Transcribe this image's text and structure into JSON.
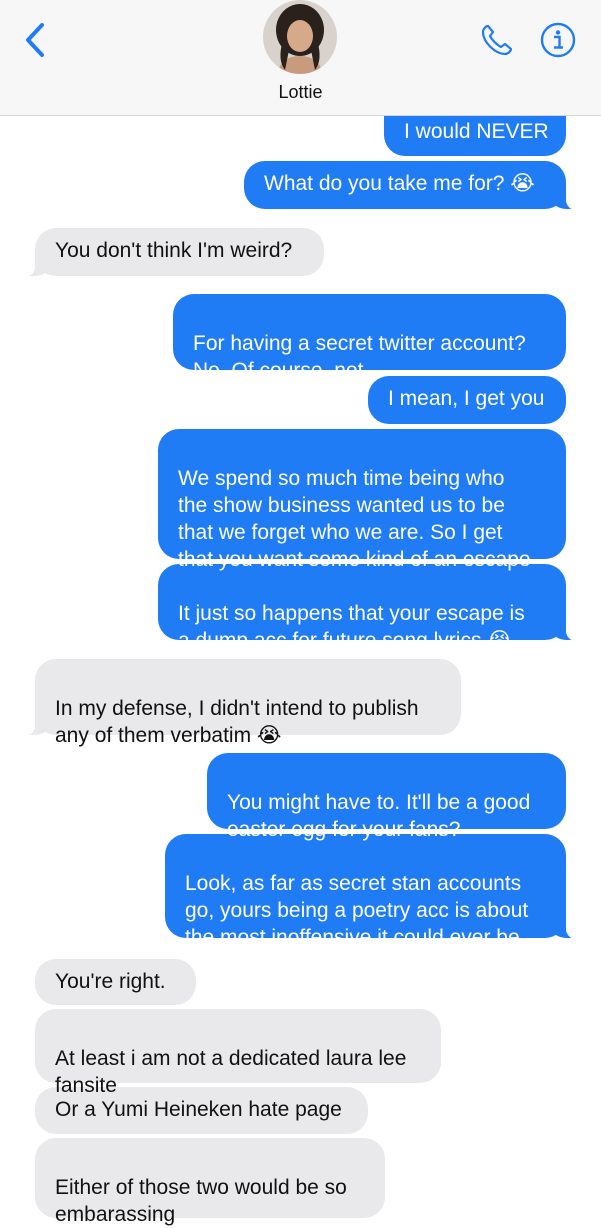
{
  "header": {
    "contact_name": "Lottie",
    "back_icon": "chevron-left-icon",
    "call_icon": "phone-icon",
    "info_icon": "info-icon",
    "accent_color": "#1f7cf5"
  },
  "messages": [
    {
      "from": "me",
      "text": "I would NEVER"
    },
    {
      "from": "me",
      "text": "What do you take me for? 😭"
    },
    {
      "from": "them",
      "text": "You don't think I'm weird?"
    },
    {
      "from": "me",
      "text": "For having a secret twitter account?\nNo. Of course, not."
    },
    {
      "from": "me",
      "text": "I mean, I get you"
    },
    {
      "from": "me",
      "text": "We spend so much time being who\nthe show business wanted us to be\nthat we forget who we are. So I get\nthat you want some kind of an escape"
    },
    {
      "from": "me",
      "text": "It just so happens that your escape is\na dump acc for future song lyrics 😭"
    },
    {
      "from": "them",
      "text": "In my defense, I didn't intend to publish\nany of them verbatim 😭"
    },
    {
      "from": "me",
      "text": "You might have to. It'll be a good\neaster egg for your fans?"
    },
    {
      "from": "me",
      "text": "Look, as far as secret stan accounts\ngo, yours being a poetry acc is about\nthe most inoffensive it could ever be"
    },
    {
      "from": "them",
      "text": "You're right."
    },
    {
      "from": "them",
      "text": "At least i am not a dedicated laura lee\nfansite"
    },
    {
      "from": "them",
      "text": "Or a Yumi Heineken hate page"
    },
    {
      "from": "them",
      "text": "Either of those two would be so\nembarassing"
    }
  ]
}
